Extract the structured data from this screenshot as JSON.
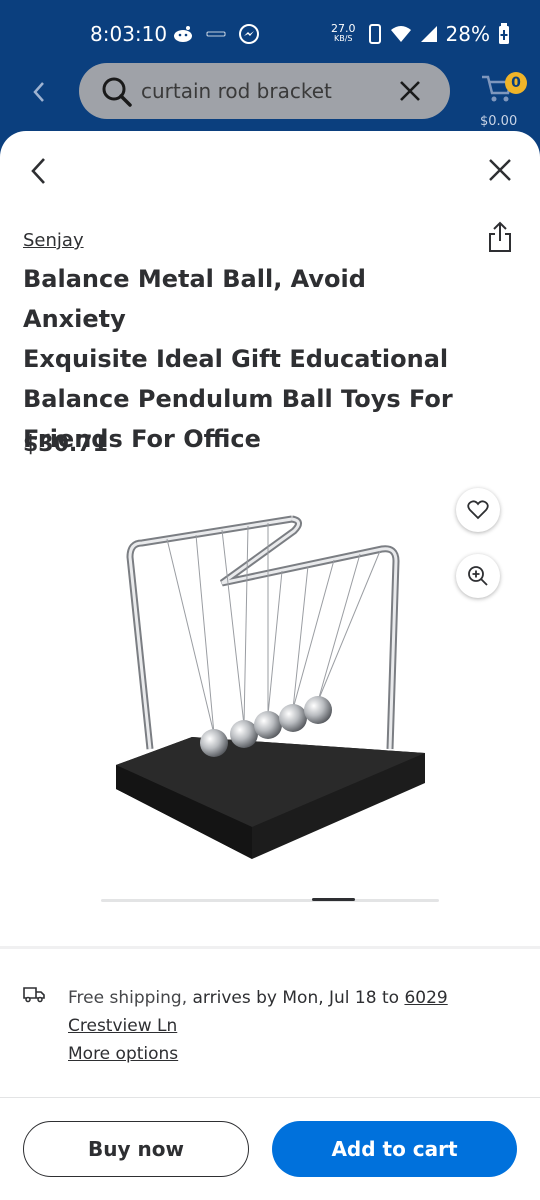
{
  "status_bar": {
    "time": "8:03:10",
    "net_speed_value": "27.0",
    "net_speed_unit": "KB/S",
    "battery": "28%"
  },
  "search": {
    "query": "curtain rod bracket"
  },
  "cart": {
    "count": "0",
    "total": "$0.00"
  },
  "product": {
    "brand": "Senjay",
    "title": "Balance Metal Ball, Avoid Anxiety\nExquisite Ideal Gift Educational\nBalance Pendulum Ball Toys  For\nFriends For Office",
    "price": "$30.71",
    "carousel_index": 5,
    "carousel_count": 8
  },
  "shipping": {
    "label": "Free shipping,",
    "arrival": " arrives by Mon, Jul 18 to ",
    "address": "6029 Crestview Ln",
    "more_options": "More options"
  },
  "actions": {
    "buy_now": "Buy now",
    "add_to_cart": "Add to cart"
  },
  "colors": {
    "header": "#0b3f7e",
    "primary": "#0071dc",
    "badge": "#f0b429"
  }
}
